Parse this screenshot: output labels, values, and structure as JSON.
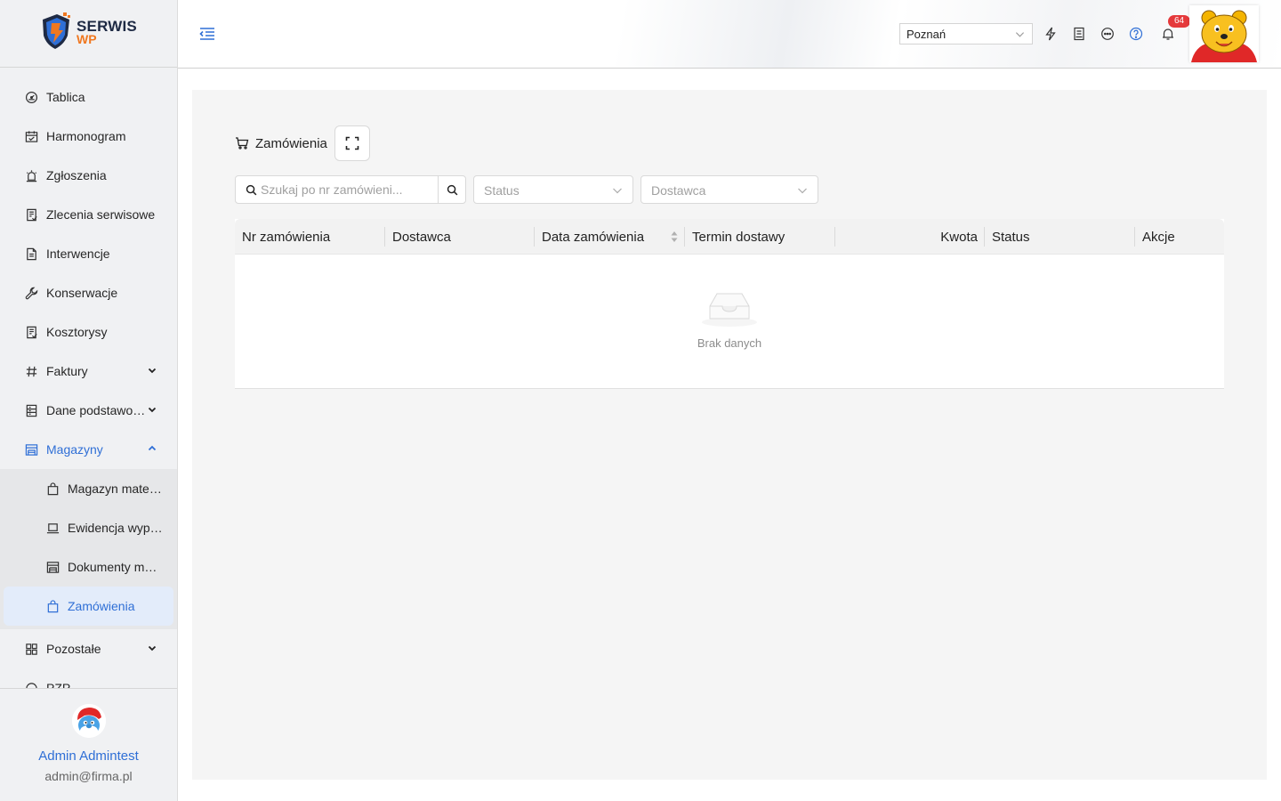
{
  "logo": {
    "line1": "SERWIS",
    "line2": "WP"
  },
  "sidebar": {
    "items": [
      {
        "label": "Tablica",
        "icon": "dashboard-icon"
      },
      {
        "label": "Harmonogram",
        "icon": "calendar-icon"
      },
      {
        "label": "Zgłoszenia",
        "icon": "alarm-icon"
      },
      {
        "label": "Zlecenia serwisowe",
        "icon": "receipt-icon"
      },
      {
        "label": "Interwencje",
        "icon": "document-icon"
      },
      {
        "label": "Konserwacje",
        "icon": "wrench-icon"
      },
      {
        "label": "Kosztorysy",
        "icon": "receipt-icon"
      },
      {
        "label": "Faktury",
        "icon": "hash-icon"
      },
      {
        "label": "Dane podstawo…",
        "icon": "database-icon"
      },
      {
        "label": "Magazyny",
        "icon": "warehouse-icon"
      },
      {
        "label": "Pozostałe",
        "icon": "grid-icon"
      },
      {
        "label": "PZP",
        "icon": "circle-icon"
      }
    ],
    "submenu": [
      {
        "label": "Magazyn mate…",
        "icon": "bag-icon"
      },
      {
        "label": "Ewidencja wyp…",
        "icon": "laptop-icon"
      },
      {
        "label": "Dokumenty m…",
        "icon": "warehouse-icon"
      },
      {
        "label": "Zamówienia",
        "icon": "bag-icon"
      }
    ]
  },
  "user": {
    "name": "Admin Admintest",
    "email": "admin@firma.pl"
  },
  "header": {
    "city": "Poznań",
    "notifications": "64",
    "accent": "#2f6fd6",
    "badge_color": "#e5393b"
  },
  "page": {
    "title": "Zamówienia",
    "search_placeholder": "Szukaj po nr zamówieni...",
    "status_placeholder": "Status",
    "supplier_placeholder": "Dostawca",
    "columns": [
      "Nr zamówienia",
      "Dostawca",
      "Data zamówienia",
      "Termin dostawy",
      "Kwota",
      "Status",
      "Akcje"
    ],
    "empty_text": "Brak danych"
  }
}
